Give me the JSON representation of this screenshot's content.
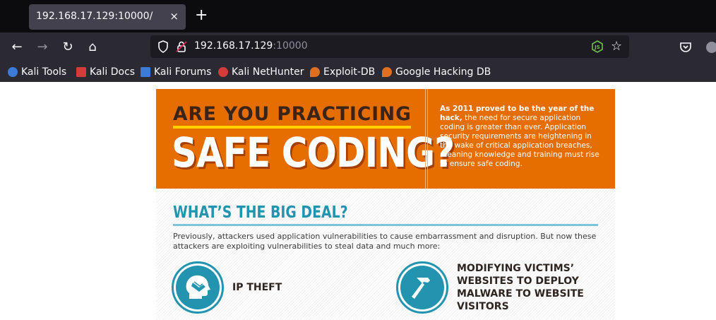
{
  "browser": {
    "tab": {
      "title": "192.168.17.129:10000/",
      "close_glyph": "×"
    },
    "new_tab_glyph": "+",
    "nav": {
      "back_glyph": "←",
      "forward_glyph": "→",
      "reload_glyph": "↻",
      "home_glyph": "⌂"
    },
    "url": {
      "host": "192.168.17.129",
      "port": ":10000"
    },
    "star_glyph": "☆",
    "bookmarks": [
      {
        "label": "Kali Tools",
        "icon": "kali-tools-icon",
        "color": "#3d7bd9"
      },
      {
        "label": "Kali Docs",
        "icon": "kali-docs-icon",
        "color": "#d43b3b"
      },
      {
        "label": "Kali Forums",
        "icon": "kali-forums-icon",
        "color": "#3d7bd9"
      },
      {
        "label": "Kali NetHunter",
        "icon": "kali-nethunter-icon",
        "color": "#d43b3b"
      },
      {
        "label": "Exploit-DB",
        "icon": "exploit-db-icon",
        "color": "#e0701f"
      },
      {
        "label": "Google Hacking DB",
        "icon": "google-hacking-db-icon",
        "color": "#e0701f"
      }
    ]
  },
  "page": {
    "hero": {
      "line1": "ARE YOU PRACTICING",
      "line2": "SAFE CODING?",
      "blurb_bold": "As 2011 proved to be the year of the hack,",
      "blurb_rest": " the need for secure application coding is greater than ever. Application security requirements are heightening in the wake of critical application breaches, meaning knowledge and training must rise to ensure safe coding."
    },
    "section": {
      "title": "WHAT’S THE BIG DEAL?",
      "body": "Previously, attackers used application vulnerabilities to cause embarrassment and disruption. But now these attackers are exploiting vulnerabilities to steal data and much more:"
    },
    "items": [
      {
        "label": "IP THEFT",
        "icon": "head-hand-icon"
      },
      {
        "label_lines": [
          "MODIFYING VICTIMS’",
          "WEBSITES TO DEPLOY",
          "MALWARE TO WEBSITE",
          "VISITORS"
        ],
        "icon": "hammer-icon"
      }
    ],
    "colors": {
      "orange": "#e66d00",
      "teal": "#2394b0",
      "yellow": "#ffd200"
    }
  }
}
